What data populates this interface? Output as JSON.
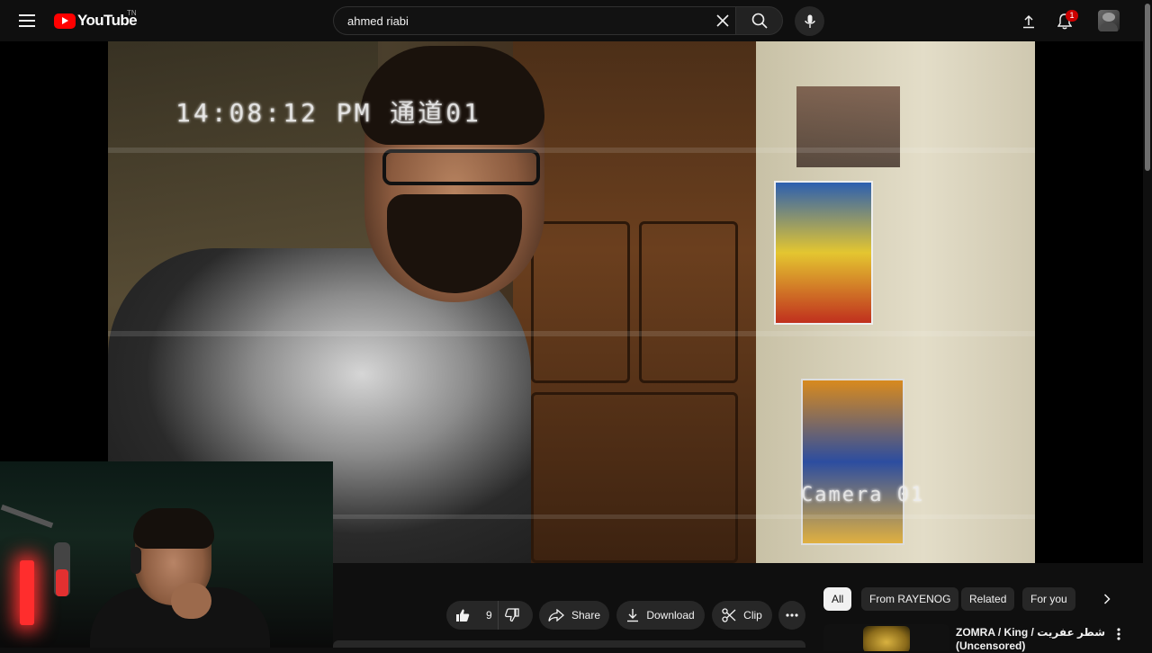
{
  "header": {
    "logo_text": "YouTube",
    "country_code": "TN",
    "search": {
      "value": "ahmed riabi",
      "placeholder": "Search"
    },
    "notifications_count": "1"
  },
  "player": {
    "osd_time": "14:08:12 PM 通道01",
    "osd_camera": "Camera 01"
  },
  "actions": {
    "like_count": "9",
    "share_label": "Share",
    "download_label": "Download",
    "clip_label": "Clip"
  },
  "chips": [
    "All",
    "From RAYENOG",
    "Related",
    "For you"
  ],
  "recommendation": {
    "title": "ZOMRA / King / شطر عفريت (Uncensored)"
  },
  "colors": {
    "accent": "#ff0000",
    "badge": "#cc0000",
    "background": "#0f0f0f",
    "pill": "#272727"
  }
}
